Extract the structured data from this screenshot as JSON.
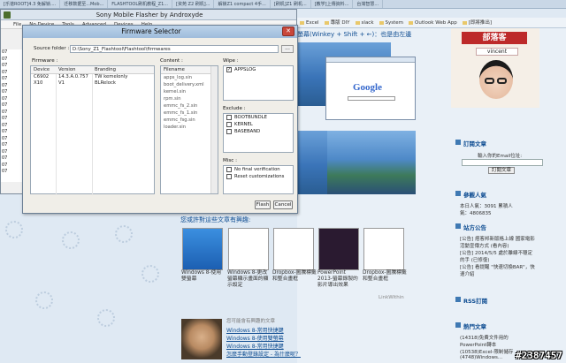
{
  "browser": {
    "tabs": [
      "[乐谱ROOT]4.3 免解锁....",
      "迁移数据至...Mob...",
      "FLASHTOOL刷机教程_Z1...",
      "[资苑 Z2 刷机]...",
      "解锁Z1 compact 4手...",
      "[刷机]Z1 刷机...",
      "[教学]上傳資料...",
      "台灣智慧..."
    ],
    "bookmarks": [
      "Excel",
      "專版 DIY",
      "slack",
      "System",
      "Outlook Web App",
      "[即將推出]"
    ]
  },
  "flasher": {
    "title": "Sony Mobile Flasher by Androxyde",
    "menu": [
      "File",
      "No Device",
      "Tools",
      "Advanced",
      "Devices",
      "Help"
    ],
    "log_lines": [
      "07",
      "07",
      "07",
      "07",
      "07",
      "07",
      "07",
      "07",
      "07",
      "07",
      "07",
      "07",
      "07",
      "07",
      "07",
      "07",
      "07",
      "07",
      "07"
    ]
  },
  "dialog": {
    "title": "Firmware Selector",
    "close_glyph": "✕",
    "source_label": "Source folder :",
    "source_value": "D:\\Sony_Z1_Flashtool\\Flashtool\\firmwares",
    "browse_label": "...",
    "firmware_label": "Firmware :",
    "columns": [
      "Device",
      "Version",
      "Branding"
    ],
    "firmwares": [
      {
        "device": "C6902",
        "version": "14.3.A.0.757",
        "branding": "TW kemelonly"
      },
      {
        "device": "X10",
        "version": "V1",
        "branding": "BLRelock"
      }
    ],
    "content_label": "Content :",
    "content_header": "Filename",
    "content_files": [
      "apps_log.sin",
      "boot_delivery.xml",
      "kernel.sin",
      "rpm.sin",
      "emmc_fs_2.sin",
      "emmc_fs_1.sin",
      "emmc_fsg.sin",
      "loader.sin"
    ],
    "wipe_label": "Wipe :",
    "wipe_items": [
      {
        "label": "APPSLOG",
        "checked": true
      }
    ],
    "exclude_label": "Exclude :",
    "exclude_items": [
      {
        "label": "BOOTBUNDLE",
        "checked": false
      },
      {
        "label": "KERNEL",
        "checked": false
      },
      {
        "label": "BASEBAND",
        "checked": false
      }
    ],
    "misc_label": "Misc :",
    "misc_items": [
      {
        "label": "No final verification",
        "checked": false
      },
      {
        "label": "Reset customizations",
        "checked": false
      }
    ],
    "flash_label": "Flash",
    "cancel_label": "Cancel"
  },
  "blog": {
    "hint_text": "螢幕(Winkey + Shift + ←)：也是由左邊",
    "google_text": "Google",
    "profile_header": "部落客",
    "profile_name": "vincent",
    "subscribe_title": "訂閱文章",
    "subscribe_text": "輸入你的Email位址:",
    "subscribe_button": "訂閱文章",
    "popular_title": "參觀人氣",
    "popular_lines": [
      "本日人氣：3091 累積人",
      "氣：4806835"
    ],
    "announce_title": "站方公告",
    "announce_lines": [
      "[公告] 痞客邦新版格上線 國家電影",
      "活動宣傳方式 (看內容)",
      "[公告] 2014/5/5 處於離線不穩定",
      "的手 (已修復)",
      "[公告] 看提醒 \"快速切換BAR\"，快",
      "速介紹"
    ],
    "rss_title": "RSS訂閱",
    "hot_title": "熱門文章",
    "hot_lines": [
      "(14318)免費文件用的",
      "PowerPoint轉本",
      "(10538)Excel-限制儲存",
      "(4748)Windows..."
    ],
    "related_title": "您或許對這些文章有興趣:",
    "related": [
      "Windows 8-使用雙螢幕",
      "Windows 8-更改螢幕顯示畫面的顯示設定",
      "Dropbox-圖騰標籤和整合畫框",
      "PowerPoint 2013-螢幕錄製的影片導出效果",
      "Dropbox-圖騰標籤和整合畫框"
    ],
    "linkwithin": "LinkWithin",
    "also_text": "您可能會有興趣的文章",
    "also_links": [
      "Windows 8-常用快捷鍵",
      "Windows 8-使用雙螢幕",
      "Windows 8-常用快捷鍵",
      "怎麼手動登錄設定 - 為什麼呢？"
    ]
  },
  "watermark": "#2387457"
}
